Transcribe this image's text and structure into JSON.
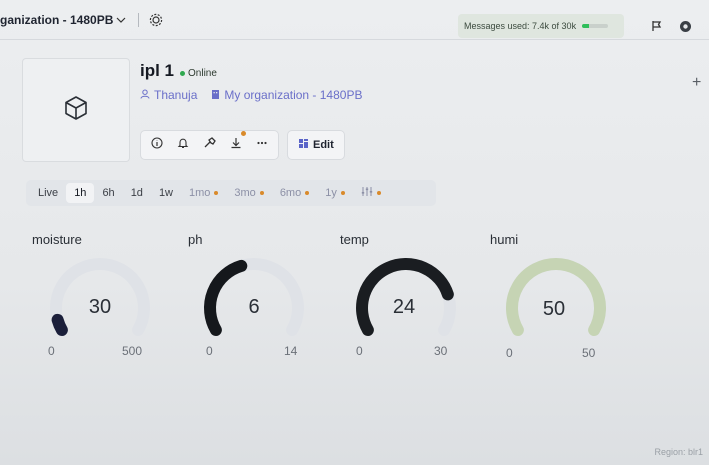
{
  "topbar": {
    "org_label": "ganization - 1480PB",
    "usage_text": "Messages used: 7.4k of 30k",
    "usage_fraction": 0.25,
    "accent": "#2fbf5a"
  },
  "device": {
    "name": "ipl 1",
    "status": "Online",
    "owner": "Thanuja",
    "organization": "My organization - 1480PB",
    "edit_label": "Edit",
    "action_icons": [
      "info-icon",
      "bell-icon",
      "wrench-icon",
      "download-icon",
      "more-icon"
    ]
  },
  "time_filters": [
    {
      "label": "Live",
      "active": false,
      "premium": false
    },
    {
      "label": "1h",
      "active": true,
      "premium": false
    },
    {
      "label": "6h",
      "active": false,
      "premium": false
    },
    {
      "label": "1d",
      "active": false,
      "premium": false
    },
    {
      "label": "1w",
      "active": false,
      "premium": false
    },
    {
      "label": "1mo",
      "active": false,
      "premium": true
    },
    {
      "label": "3mo",
      "active": false,
      "premium": true
    },
    {
      "label": "6mo",
      "active": false,
      "premium": true
    },
    {
      "label": "1y",
      "active": false,
      "premium": true
    }
  ],
  "widgets": [
    {
      "title": "moisture",
      "value": "30",
      "min": "0",
      "max": "500",
      "fraction": 0.06,
      "color": "#1b1f3a",
      "track": "#dfe2e7"
    },
    {
      "title": "ph",
      "value": "6",
      "min": "0",
      "max": "14",
      "fraction": 0.43,
      "color": "#15181c",
      "track": "#dfe2e7"
    },
    {
      "title": "temp",
      "value": "24",
      "min": "0",
      "max": "30",
      "fraction": 0.8,
      "color": "#1a1d21",
      "track": "#dfe2e7"
    },
    {
      "title": "humi",
      "value": "50",
      "min": "0",
      "max": "50",
      "fraction": 1.0,
      "color": "#c6d4b4",
      "track": "#dfe2e7"
    }
  ],
  "footer": {
    "region": "Region: blr1"
  }
}
